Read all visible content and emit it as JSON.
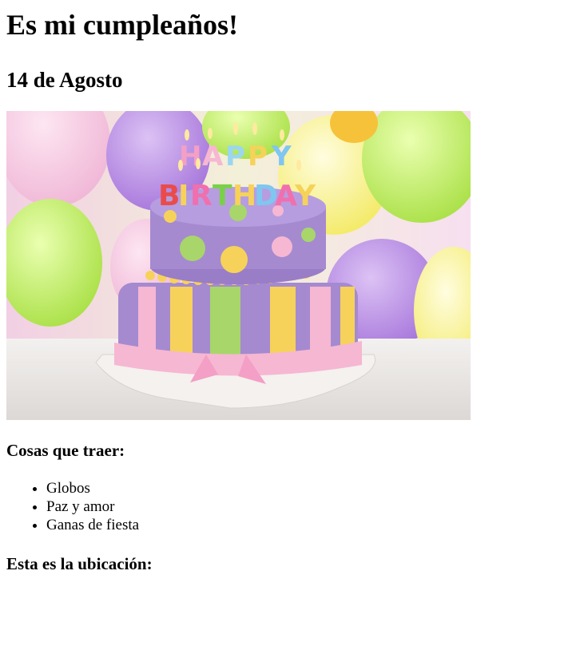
{
  "heading": {
    "title": "Es mi cumpleaños!",
    "date": "14 de Agosto"
  },
  "hero": {
    "image_subject": "birthday-cake-with-balloons",
    "candles_top": "HAPPY",
    "candles_bottom": "BIRTHDAY",
    "colors": {
      "cake_purple": "#a58ad0",
      "ribbon_pink": "#f6b7d2",
      "stripe_yellow": "#f6d25a",
      "stripe_green": "#a8d66a",
      "balloon_green": "#c9f05a",
      "balloon_yellow": "#f8f27a",
      "balloon_purple": "#b27fe0"
    }
  },
  "things": {
    "heading": "Cosas que traer:",
    "items": [
      "Globos",
      "Paz y amor",
      "Ganas de fiesta"
    ]
  },
  "location": {
    "heading": "Esta es la ubicación:"
  }
}
